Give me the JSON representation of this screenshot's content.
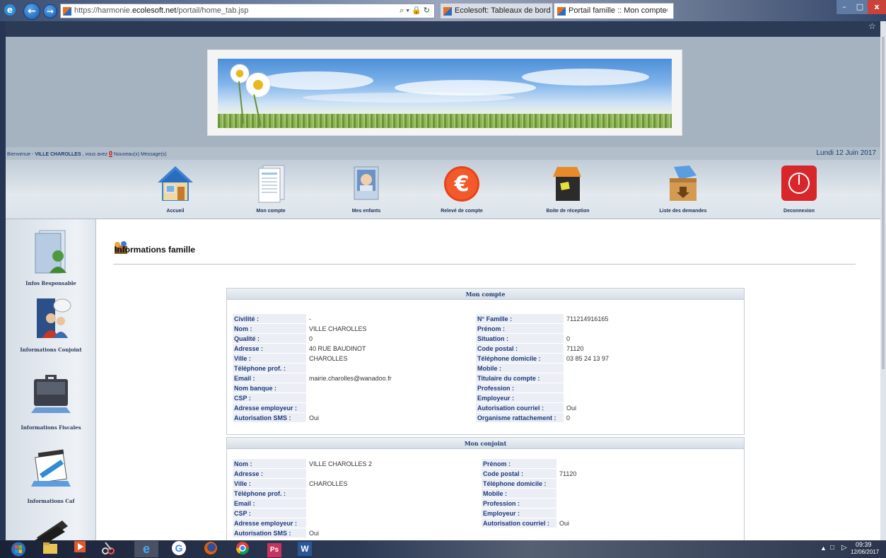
{
  "browser": {
    "url_prefix": "https://harmonie.",
    "url_domain": "ecolesoft.net",
    "url_path": "/portail/home_tab.jsp",
    "address_tools": "⌕ ▾ 🔒 ↻",
    "tabs": [
      {
        "label": "Ecolesoft: Tableaux de bord"
      },
      {
        "label": "Portail famille :: Mon compte",
        "close": "×"
      }
    ],
    "window_controls": {
      "min": "–",
      "max": "□",
      "close": "x"
    },
    "favorites_icon": "☆"
  },
  "header": {
    "welcome_prefix": "Bienvenue - ",
    "welcome_name": "VILLE CHAROLLES",
    "welcome_middle": " , vous avez ",
    "message_count": "0",
    "message_suffix": " Nouveau(x) Message(s)",
    "date": "Lundi 12 Juin 2017"
  },
  "nav": {
    "items": [
      {
        "label": "Accueil",
        "icon": "house-icon"
      },
      {
        "label": "Mon compte",
        "icon": "documents-icon"
      },
      {
        "label": "Mes enfants",
        "icon": "photo-icon"
      },
      {
        "label": "Relevé de compte",
        "icon": "euro-icon"
      },
      {
        "label": "Boite de réception",
        "icon": "inbox-icon"
      },
      {
        "label": "Liste des demandes",
        "icon": "box-icon"
      },
      {
        "label": "Deconnexion",
        "icon": "power-icon"
      }
    ]
  },
  "sidebar": {
    "items": [
      {
        "label": "Infos Responsable"
      },
      {
        "label": "Informations Conjoint"
      },
      {
        "label": "Informations Fiscales"
      },
      {
        "label": "Informations Caf"
      }
    ]
  },
  "main": {
    "section_title": "Informations famille",
    "compte": {
      "title": "Mon compte",
      "left": [
        {
          "k": "Civilité :",
          "v": "-"
        },
        {
          "k": "Nom :",
          "v": "VILLE CHAROLLES"
        },
        {
          "k": "Qualité :",
          "v": "0"
        },
        {
          "k": "Adresse :",
          "v": "40 RUE BAUDINOT"
        },
        {
          "k": "Ville :",
          "v": "CHAROLLES"
        },
        {
          "k": "Téléphone prof. :",
          "v": ""
        },
        {
          "k": "Email :",
          "v": "mairie.charolles@wanadoo.fr"
        },
        {
          "k": "Nom banque :",
          "v": ""
        },
        {
          "k": "CSP :",
          "v": ""
        },
        {
          "k": "Adresse employeur :",
          "v": ""
        },
        {
          "k": "Autorisation SMS :",
          "v": "Oui"
        }
      ],
      "right": [
        {
          "k": "N° Famille :",
          "v": "711214916165"
        },
        {
          "k": "Prénom :",
          "v": ""
        },
        {
          "k": "Situation :",
          "v": "0"
        },
        {
          "k": "Code postal :",
          "v": "71120"
        },
        {
          "k": "Téléphone domicile :",
          "v": "03 85 24 13 97"
        },
        {
          "k": "Mobile :",
          "v": ""
        },
        {
          "k": "Titulaire du compte :",
          "v": ""
        },
        {
          "k": "Profession :",
          "v": ""
        },
        {
          "k": "Employeur :",
          "v": ""
        },
        {
          "k": "Autorisation courriel :",
          "v": "Oui"
        },
        {
          "k": "Organisme rattachement :",
          "v": "0"
        }
      ]
    },
    "conjoint": {
      "title": "Mon conjoint",
      "left": [
        {
          "k": "Nom :",
          "v": "VILLE CHAROLLES 2"
        },
        {
          "k": "Adresse :",
          "v": ""
        },
        {
          "k": "Ville :",
          "v": "CHAROLLES"
        },
        {
          "k": "Téléphone prof. :",
          "v": ""
        },
        {
          "k": "Email :",
          "v": ""
        },
        {
          "k": "CSP :",
          "v": ""
        },
        {
          "k": "Adresse employeur :",
          "v": ""
        },
        {
          "k": "Autorisation SMS :",
          "v": "Oui"
        }
      ],
      "right": [
        {
          "k": "Prénom :",
          "v": ""
        },
        {
          "k": "Code postal :",
          "v": "71120"
        },
        {
          "k": "Téléphone domicile :",
          "v": ""
        },
        {
          "k": "Mobile :",
          "v": ""
        },
        {
          "k": "Profession :",
          "v": ""
        },
        {
          "k": "Employeur :",
          "v": ""
        },
        {
          "k": "Autorisation courriel :",
          "v": "Oui"
        }
      ]
    }
  },
  "taskbar": {
    "apps": [
      "start-orb",
      "file-explorer",
      "media-player",
      "snipping-tool",
      "internet-explorer",
      "google-chrome-search",
      "firefox",
      "chrome",
      "photoshop",
      "word"
    ],
    "ps_label": "Ps",
    "word_label": "W",
    "g_label": "G",
    "clock_time": "09:39",
    "clock_date": "12/06/2017"
  }
}
